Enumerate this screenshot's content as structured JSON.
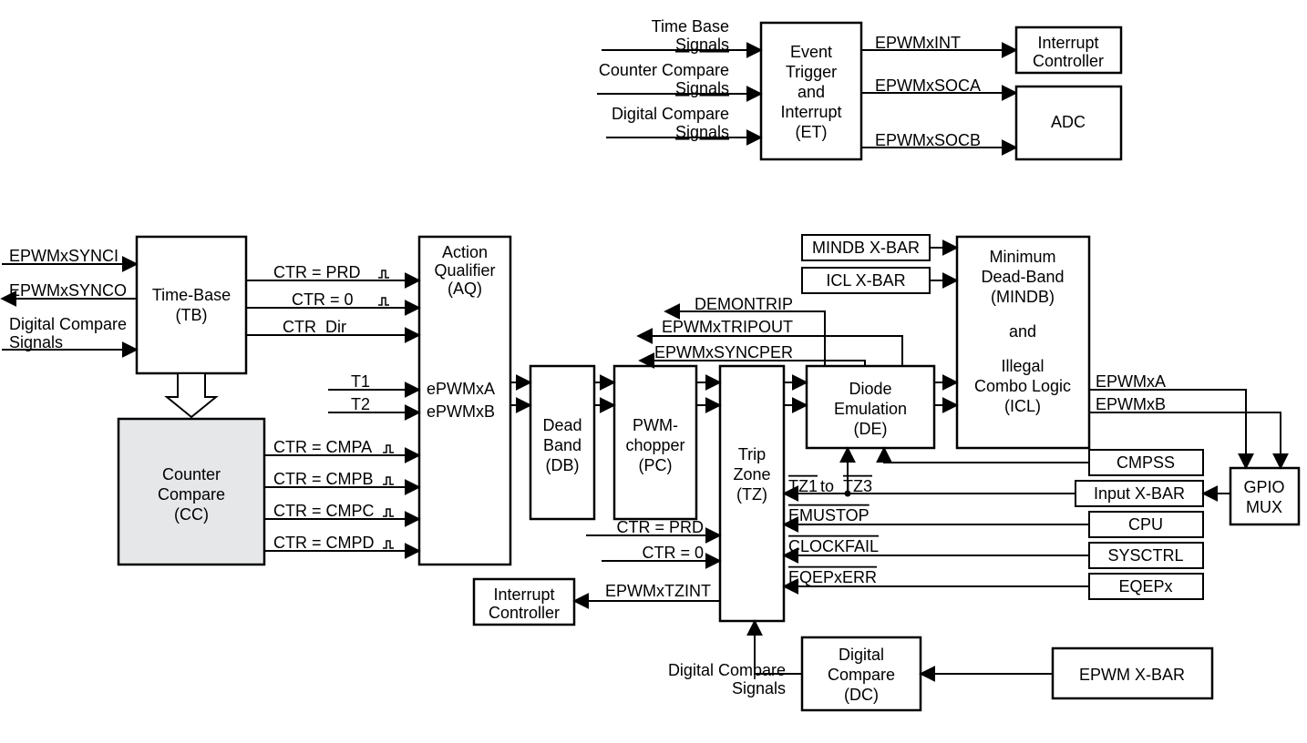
{
  "top": {
    "in1": {
      "l1": "Time Base",
      "l2": "Signals"
    },
    "in2": {
      "l1": "Counter Compare",
      "l2": "Signals"
    },
    "in3": {
      "l1": "Digital Compare",
      "l2": "Signals"
    },
    "et": {
      "l1": "Event",
      "l2": "Trigger",
      "l3": "and",
      "l4": "Interrupt",
      "l5": "(ET)"
    },
    "intlbl": "EPWMxINT",
    "socalbl": "EPWMxSOCA",
    "socblbl": "EPWMxSOCB",
    "intctl": {
      "l1": "Interrupt",
      "l2": "Controller"
    },
    "adc": "ADC"
  },
  "left": {
    "synci": "EPWMxSYNCI",
    "synco": "EPWMxSYNCO",
    "dcs": {
      "l1": "Digital Compare",
      "l2": "Signals"
    },
    "tb": {
      "l1": "Time-Base",
      "l2": "(TB)"
    },
    "cc": {
      "l1": "Counter",
      "l2": "Compare",
      "l3": "(CC)"
    }
  },
  "aq": {
    "title": {
      "l1": "Action",
      "l2": "Qualifier",
      "l3": "(AQ)"
    },
    "ctrprd": "CTR = PRD",
    "ctr0": "CTR = 0",
    "ctrdir": "CTR_Dir",
    "t1": "T1",
    "t2": "T2",
    "pwma": "ePWMxA",
    "pwmb": "ePWMxB",
    "cmpa": "CTR = CMPA",
    "cmpb": "CTR = CMPB",
    "cmpc": "CTR = CMPC",
    "cmpd": "CTR = CMPD"
  },
  "db": {
    "l1": "Dead",
    "l2": "Band",
    "l3": "(DB)"
  },
  "pc": {
    "l1": "PWM-",
    "l2": "chopper",
    "l3": "(PC)"
  },
  "tz": {
    "title": {
      "l1": "Trip",
      "l2": "Zone",
      "l3": "(TZ)"
    },
    "ctrprd": "CTR = PRD",
    "ctr0": "CTR = 0",
    "tzint": "EPWMxTZINT",
    "intctl": {
      "l1": "Interrupt",
      "l2": "Controller"
    }
  },
  "de": {
    "l1": "Diode",
    "l2": "Emulation",
    "l3": "(DE)"
  },
  "mindb": {
    "l1": "Minimum",
    "l2": "Dead-Band",
    "l3": "(MINDB)",
    "and": "and",
    "l4": "Illegal",
    "l5": "Combo Logic",
    "l6": "(ICL)"
  },
  "rside": {
    "mindbx": "MINDB X-BAR",
    "iclx": "ICL X-BAR",
    "demontrip": "DEMONTRIP",
    "tripout": "EPWMxTRIPOUT",
    "syncper": "EPWMxSYNCPER",
    "epwmxa": "EPWMxA",
    "epwmxb": "EPWMxB",
    "cmpss": "CMPSS",
    "inxbar": "Input X-BAR",
    "cpu": "CPU",
    "sysctrl": "SYSCTRL",
    "eqepx": "EQEPx",
    "tz13a": "TZ1",
    "tz13b": " to ",
    "tz13c": "TZ3",
    "emustop": "EMUSTOP",
    "clockfail": "CLOCKFAIL",
    "eqeperr": "EQEPxERR",
    "gpio": {
      "l1": "GPIO",
      "l2": "MUX"
    }
  },
  "bottom": {
    "dcsig": {
      "l1": "Digital Compare",
      "l2": "Signals"
    },
    "dc": {
      "l1": "Digital",
      "l2": "Compare",
      "l3": "(DC)"
    },
    "epwmxbar": "EPWM X-BAR"
  }
}
